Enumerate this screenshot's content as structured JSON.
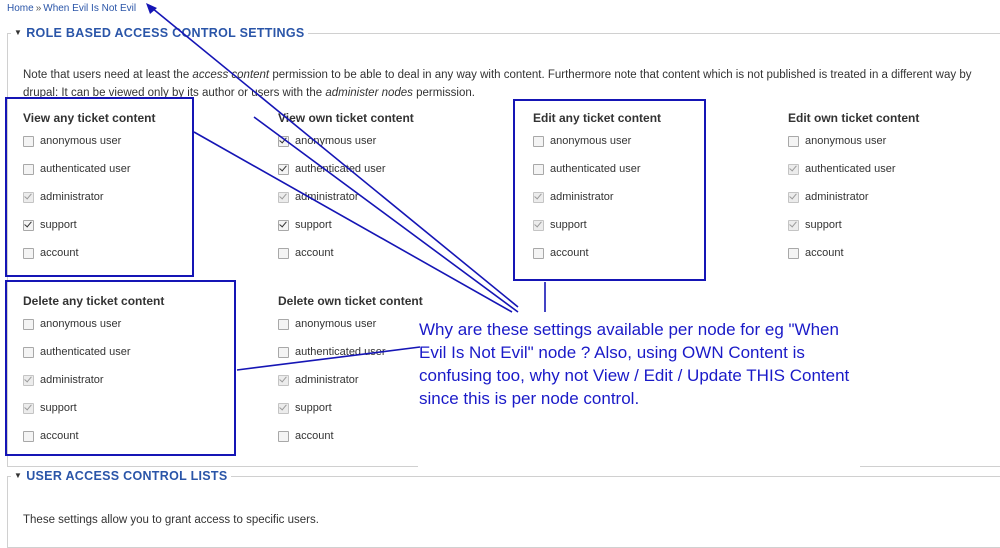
{
  "breadcrumb": {
    "home": "Home",
    "separator": "»",
    "current": "When Evil Is Not Evil"
  },
  "role_section": {
    "title": "ROLE BASED ACCESS CONTROL SETTINGS",
    "desc_part1": "Note that users need at least the ",
    "desc_em1": "access content",
    "desc_part2": " permission to be able to deal in any way with content. Furthermore note that content which is not published is treated in a different way by drupal: It can be viewed only by its author or users with the ",
    "desc_em2": "administer nodes",
    "desc_part3": " permission."
  },
  "groups": [
    {
      "title": "View any ticket content",
      "options": [
        {
          "label": "anonymous user",
          "checked": false,
          "disabled": false
        },
        {
          "label": "authenticated user",
          "checked": false,
          "disabled": false
        },
        {
          "label": "administrator",
          "checked": true,
          "disabled": true
        },
        {
          "label": "support",
          "checked": true,
          "disabled": false
        },
        {
          "label": "account",
          "checked": false,
          "disabled": false
        }
      ]
    },
    {
      "title": "View own ticket content",
      "options": [
        {
          "label": "anonymous user",
          "checked": true,
          "disabled": false
        },
        {
          "label": "authenticated user",
          "checked": true,
          "disabled": false
        },
        {
          "label": "administrator",
          "checked": true,
          "disabled": true
        },
        {
          "label": "support",
          "checked": true,
          "disabled": false
        },
        {
          "label": "account",
          "checked": false,
          "disabled": false
        }
      ]
    },
    {
      "title": "Edit any ticket content",
      "options": [
        {
          "label": "anonymous user",
          "checked": false,
          "disabled": false
        },
        {
          "label": "authenticated user",
          "checked": false,
          "disabled": false
        },
        {
          "label": "administrator",
          "checked": true,
          "disabled": true
        },
        {
          "label": "support",
          "checked": true,
          "disabled": true
        },
        {
          "label": "account",
          "checked": false,
          "disabled": false
        }
      ]
    },
    {
      "title": "Edit own ticket content",
      "options": [
        {
          "label": "anonymous user",
          "checked": false,
          "disabled": false
        },
        {
          "label": "authenticated user",
          "checked": true,
          "disabled": true
        },
        {
          "label": "administrator",
          "checked": true,
          "disabled": true
        },
        {
          "label": "support",
          "checked": true,
          "disabled": true
        },
        {
          "label": "account",
          "checked": false,
          "disabled": false
        }
      ]
    },
    {
      "title": "Delete any ticket content",
      "options": [
        {
          "label": "anonymous user",
          "checked": false,
          "disabled": false
        },
        {
          "label": "authenticated user",
          "checked": false,
          "disabled": false
        },
        {
          "label": "administrator",
          "checked": true,
          "disabled": true
        },
        {
          "label": "support",
          "checked": true,
          "disabled": true
        },
        {
          "label": "account",
          "checked": false,
          "disabled": false
        }
      ]
    },
    {
      "title": "Delete own ticket content",
      "options": [
        {
          "label": "anonymous user",
          "checked": false,
          "disabled": false
        },
        {
          "label": "authenticated user",
          "checked": false,
          "disabled": false
        },
        {
          "label": "administrator",
          "checked": true,
          "disabled": true
        },
        {
          "label": "support",
          "checked": true,
          "disabled": true
        },
        {
          "label": "account",
          "checked": false,
          "disabled": false
        }
      ]
    }
  ],
  "annotation": {
    "text": "Why are these settings available per node for eg \"When Evil Is Not Evil\" node ? Also, using OWN Content is confusing too, why not View / Edit / Update THIS Content since this is per node control.",
    "color": "#1a1ac8"
  },
  "user_section": {
    "title": "USER ACCESS CONTROL LISTS",
    "desc": "These settings allow you to grant access to specific users."
  },
  "icons": {
    "collapse": "triangle-down-icon",
    "checkbox": "checkbox-icon"
  }
}
